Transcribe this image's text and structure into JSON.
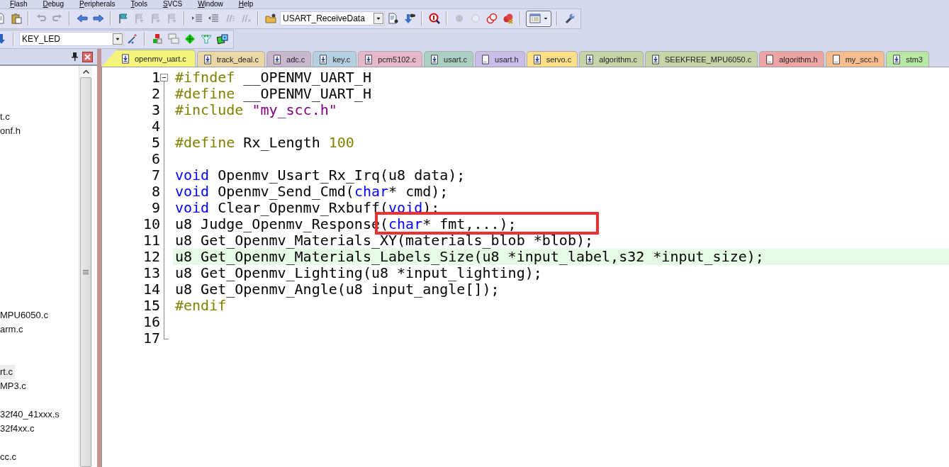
{
  "menu": [
    "Flash",
    "Debug",
    "Peripherals",
    "Tools",
    "SVCS",
    "Window",
    "Help"
  ],
  "toolbar_1": {
    "buttons": [
      {
        "disabled": false,
        "pressed": false
      },
      {
        "disabled": false,
        "pressed": false
      },
      {
        "disabled": true,
        "pressed": false
      },
      {
        "disabled": true,
        "pressed": false
      },
      {
        "disabled": false,
        "pressed": false
      },
      {
        "disabled": false,
        "pressed": false
      },
      {
        "disabled": false,
        "pressed": false
      },
      {
        "disabled": true,
        "pressed": false
      },
      {
        "disabled": true,
        "pressed": false
      },
      {
        "disabled": true,
        "pressed": false
      },
      {
        "disabled": false,
        "pressed": false
      },
      {
        "disabled": false,
        "pressed": false
      },
      {
        "disabled": true,
        "pressed": false
      },
      {
        "disabled": true,
        "pressed": false
      },
      {
        "disabled": false,
        "pressed": false
      },
      {
        "disabled": false,
        "pressed": false
      },
      {
        "disabled": false,
        "pressed": false
      },
      {
        "disabled": false,
        "pressed": false
      },
      {
        "disabled": true,
        "pressed": false
      },
      {
        "disabled": true,
        "pressed": false
      },
      {
        "disabled": false,
        "pressed": false
      },
      {
        "disabled": false,
        "pressed": false
      },
      {
        "disabled": false,
        "pressed": true
      },
      {
        "disabled": false,
        "pressed": false
      }
    ],
    "function_combo": "USART_ReceiveData"
  },
  "toolbar_2": {
    "buttons": [
      {
        "disabled": false,
        "pressed": false
      },
      {
        "disabled": false,
        "pressed": false
      },
      {
        "disabled": false,
        "pressed": false
      },
      {
        "disabled": false,
        "pressed": false
      },
      {
        "disabled": false,
        "pressed": false
      },
      {
        "disabled": false,
        "pressed": false
      },
      {
        "disabled": false,
        "pressed": false
      }
    ],
    "target_combo": "KEY_LED"
  },
  "project_tree": [
    {
      "text": "t.c",
      "selected": false
    },
    {
      "text": "onf.h",
      "selected": false
    },
    {
      "text": "MPU6050.c",
      "selected": false
    },
    {
      "text": "arm.c",
      "selected": false
    },
    {
      "text": "rt.c",
      "selected": true
    },
    {
      "text": "MP3.c",
      "selected": false
    },
    {
      "text": "32f40_41xxx.s",
      "selected": false
    },
    {
      "text": "32f4xx.c",
      "selected": false
    },
    {
      "text": "cc.c",
      "selected": false
    }
  ],
  "tabs": [
    {
      "label": "openmv_uart.c",
      "kind": "source",
      "color": "#f5f57d",
      "selected": true
    },
    {
      "label": "track_deal.c",
      "kind": "source",
      "color": "#ecd8a6",
      "selected": false
    },
    {
      "label": "adc.c",
      "kind": "source",
      "color": "#c7b8cc",
      "selected": false
    },
    {
      "label": "key.c",
      "kind": "source",
      "color": "#b5d0e2",
      "selected": false
    },
    {
      "label": "pcm5102.c",
      "kind": "source",
      "color": "#e6b8c9",
      "selected": false
    },
    {
      "label": "usart.c",
      "kind": "source",
      "color": "#a9d0c0",
      "selected": false
    },
    {
      "label": "usart.h",
      "kind": "header",
      "color": "#c9bdea",
      "selected": false
    },
    {
      "label": "servo.c",
      "kind": "source",
      "color": "#fcdf86",
      "selected": false
    },
    {
      "label": "algorithm.c",
      "kind": "source",
      "color": "#c6d5a8",
      "selected": false
    },
    {
      "label": "SEEKFREE_MPU6050.c",
      "kind": "source",
      "color": "#c6d5a8",
      "selected": false
    },
    {
      "label": "algorithm.h",
      "kind": "header",
      "color": "#eda4a4",
      "selected": false
    },
    {
      "label": "my_scc.h",
      "kind": "header",
      "color": "#f8bd8e",
      "selected": false
    },
    {
      "label": "stm3",
      "kind": "source",
      "color": "#b8e8a6",
      "selected": false
    }
  ],
  "editor": {
    "lines": [
      {
        "number": "1",
        "current": false,
        "annotated": false,
        "tokens": [
          {
            "kind": "preprocessor",
            "text": "#ifndef"
          },
          {
            "kind": "plain",
            "text": " __OPENMV_UART_H"
          }
        ]
      },
      {
        "number": "2",
        "current": false,
        "annotated": false,
        "tokens": [
          {
            "kind": "preprocessor",
            "text": "#define"
          },
          {
            "kind": "plain",
            "text": " __OPENMV_UART_H"
          }
        ]
      },
      {
        "number": "3",
        "current": false,
        "annotated": false,
        "tokens": [
          {
            "kind": "preprocessor",
            "text": "#include "
          },
          {
            "kind": "string",
            "text": "\"my_scc.h\""
          }
        ]
      },
      {
        "number": "4",
        "current": false,
        "annotated": false
      },
      {
        "number": "5",
        "current": false,
        "annotated": false,
        "tokens": [
          {
            "kind": "preprocessor",
            "text": "#define"
          },
          {
            "kind": "plain",
            "text": " Rx_Length "
          },
          {
            "kind": "number",
            "text": "100"
          }
        ]
      },
      {
        "number": "6",
        "current": false,
        "annotated": false
      },
      {
        "number": "7",
        "current": false,
        "annotated": false,
        "tokens": [
          {
            "kind": "keyword",
            "text": "void"
          },
          {
            "kind": "plain",
            "text": " Openmv_Usart_Rx_Irq(u8 data);"
          }
        ]
      },
      {
        "number": "8",
        "current": false,
        "annotated": false,
        "tokens": [
          {
            "kind": "keyword",
            "text": "void"
          },
          {
            "kind": "plain",
            "text": " Openmv_Send_Cmd("
          },
          {
            "kind": "keyword",
            "text": "char"
          },
          {
            "kind": "plain",
            "text": "* cmd);"
          }
        ]
      },
      {
        "number": "9",
        "current": false,
        "annotated": false,
        "tokens": [
          {
            "kind": "keyword",
            "text": "void"
          },
          {
            "kind": "plain",
            "text": " Clear_Openmv_Rxbuff("
          },
          {
            "kind": "keyword",
            "text": "void"
          },
          {
            "kind": "plain",
            "text": ");"
          }
        ]
      },
      {
        "number": "10",
        "current": false,
        "annotated": true,
        "tokens": [
          {
            "kind": "plain",
            "text": "u8 Judge_Openmv_Response("
          },
          {
            "kind": "keyword",
            "text": "char"
          },
          {
            "kind": "plain",
            "text": "* fmt,...);"
          }
        ]
      },
      {
        "number": "11",
        "current": false,
        "annotated": false,
        "tokens": [
          {
            "kind": "plain",
            "text": "u8 Get_Openmv_Materials_XY(materials_blob *blob);"
          }
        ]
      },
      {
        "number": "12",
        "current": true,
        "annotated": false,
        "tokens": [
          {
            "kind": "plain",
            "text": "u8 Get_Openmv_Materials_Labels_Size(u8 *input_label,s32 *input_size);"
          }
        ]
      },
      {
        "number": "13",
        "current": false,
        "annotated": false,
        "tokens": [
          {
            "kind": "plain",
            "text": "u8 Get_Openmv_Lighting(u8 *input_lighting);"
          }
        ]
      },
      {
        "number": "14",
        "current": false,
        "annotated": false,
        "tokens": [
          {
            "kind": "plain",
            "text": "u8 Get_Openmv_Angle(u8 input_angle[]);"
          }
        ]
      },
      {
        "number": "15",
        "current": false,
        "annotated": false,
        "tokens": [
          {
            "kind": "preprocessor",
            "text": "#endif"
          }
        ]
      },
      {
        "number": "16",
        "current": false,
        "annotated": false
      },
      {
        "number": "17",
        "current": false,
        "annotated": false
      }
    ],
    "fold_region": {
      "expanded": true
    }
  }
}
